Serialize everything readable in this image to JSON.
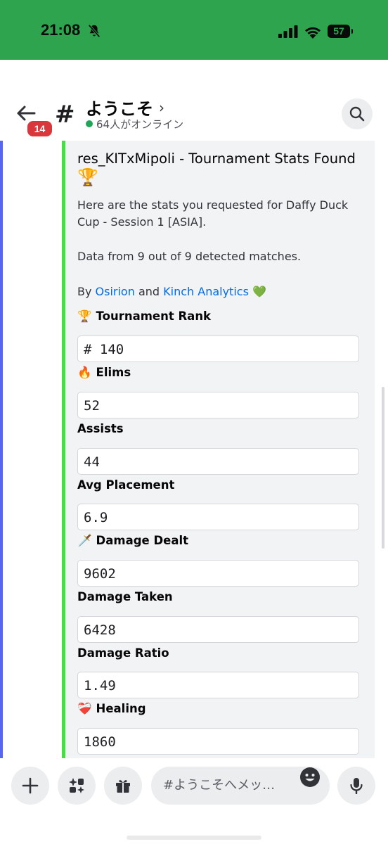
{
  "status_bar": {
    "time": "21:08",
    "battery": "57"
  },
  "header": {
    "unread_count": "14",
    "channel_name": "ようこそ",
    "online_text": "64人がオンライン"
  },
  "embed": {
    "accent_color": "#43e043",
    "title": "res_KITxMipoli - Tournament Stats Found",
    "title_emoji": "🏆",
    "description_line1": "Here are the stats you requested for Daffy Duck Cup - Session 1 [ASIA].",
    "description_line2": "Data from 9 out of 9 detected matches.",
    "by_prefix": "By ",
    "link1": "Osirion",
    "and": " and ",
    "link2": "Kinch Analytics",
    "heart": "💚",
    "fields": [
      {
        "emoji": "🏆",
        "name": "Tournament Rank",
        "value": "# 140"
      },
      {
        "emoji": "🔥",
        "name": "Elims",
        "value": "52"
      },
      {
        "emoji": "",
        "name": "Assists",
        "value": "44"
      },
      {
        "emoji": "",
        "name": "Avg Placement",
        "value": "6.9"
      },
      {
        "emoji": "🗡️",
        "name": "Damage Dealt",
        "value": "9602"
      },
      {
        "emoji": "",
        "name": "Damage Taken",
        "value": "6428"
      },
      {
        "emoji": "",
        "name": "Damage Ratio",
        "value": "1.49"
      },
      {
        "emoji": "❤️‍🩹",
        "name": "Healing",
        "value": "1860"
      }
    ]
  },
  "composer": {
    "placeholder": "#ようこそへメッ…"
  },
  "icons": [
    "bell-slash-icon",
    "signal-icon",
    "wifi-icon",
    "battery-icon",
    "back-arrow-icon",
    "hash-icon",
    "chevron-right-icon",
    "search-icon",
    "plus-icon",
    "apps-icon",
    "gift-icon",
    "emoji-icon",
    "microphone-icon"
  ]
}
